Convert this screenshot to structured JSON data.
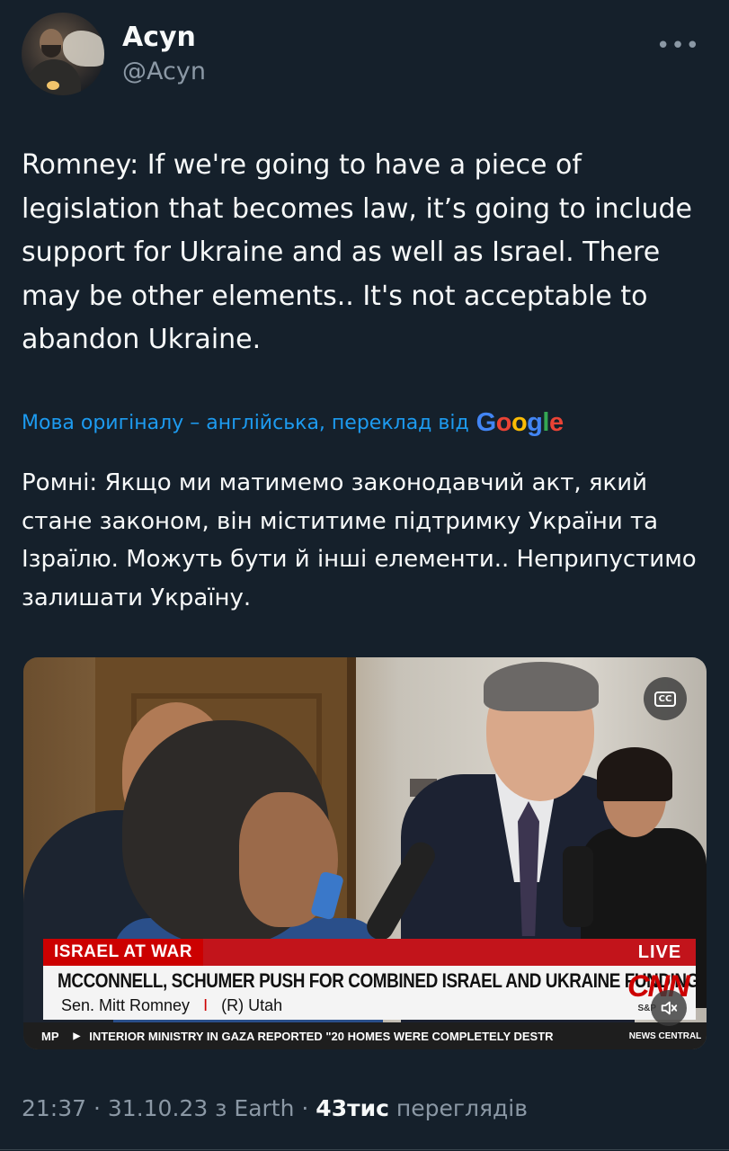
{
  "author": {
    "name": "Acyn",
    "handle": "@Acyn"
  },
  "more_label": "•••",
  "tweet": {
    "text": "Romney: If we're going to have a piece of legislation that becomes law, it’s going to include support for Ukraine and as well as Israel. There may be other elements..  It's not acceptable to abandon Ukraine."
  },
  "translation": {
    "note": "Мова оригіналу – англійська, переклад від",
    "provider": "Google",
    "text": "Ромні: Якщо ми матимемо законодавчий акт, який стане законом, він міститиме підтримку України та Ізраїлю. Можуть бути й інші елементи.. Неприпустимо залишати Україну."
  },
  "video": {
    "cc_label": "CC",
    "tag": "ISRAEL AT WAR",
    "live": "LIVE",
    "headline": "MCCONNELL, SCHUMER PUSH FOR COMBINED ISRAEL AND UKRAINE FUNDING",
    "subline_name": "Sen. Mitt Romney",
    "subline_sep": "I",
    "subline_party": "(R) Utah",
    "network": "CNN",
    "market": "S&P",
    "ticker_left": "MP",
    "ticker_text": "INTERIOR MINISTRY IN GAZA REPORTED \"20 HOMES WERE COMPLETELY DESTR",
    "ticker_brand": "NEWS CENTRAL"
  },
  "meta": {
    "time": "21:37",
    "sep1": " · ",
    "date": "31.10.23",
    "via": " з Earth",
    "sep2": " · ",
    "views": "43тис",
    "views_label": " переглядів"
  },
  "colors": {
    "background": "#15202b",
    "link": "#1d9bf0",
    "secondary_text": "#8b98a5",
    "cnn_red": "#cc0000"
  }
}
